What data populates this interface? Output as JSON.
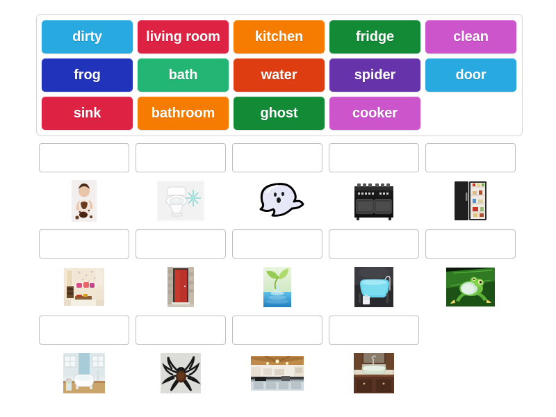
{
  "activity": {
    "type": "match-up",
    "tile_bank": {
      "rows": [
        [
          {
            "label": "dirty",
            "color": "#28a9e0"
          },
          {
            "label": "living room",
            "color": "#dd2244"
          },
          {
            "label": "kitchen",
            "color": "#f57c00"
          },
          {
            "label": "fridge",
            "color": "#128a36"
          },
          {
            "label": "clean",
            "color": "#cc55cc"
          }
        ],
        [
          {
            "label": "frog",
            "color": "#2233bb"
          },
          {
            "label": "bath",
            "color": "#22b573"
          },
          {
            "label": "water",
            "color": "#dd3d11"
          },
          {
            "label": "spider",
            "color": "#6633aa"
          },
          {
            "label": "door",
            "color": "#28a9e0"
          }
        ],
        [
          {
            "label": "sink",
            "color": "#dd2244"
          },
          {
            "label": "bathroom",
            "color": "#f57c00"
          },
          {
            "label": "ghost",
            "color": "#128a36"
          },
          {
            "label": "cooker",
            "color": "#cc55cc"
          }
        ]
      ]
    },
    "answer_rows": [
      [
        {
          "drop_value": "",
          "image": "dirty-child-photo"
        },
        {
          "drop_value": "",
          "image": "toilet-photo"
        },
        {
          "drop_value": "",
          "image": "ghost-clipart"
        },
        {
          "drop_value": "",
          "image": "cooker-range-photo"
        },
        {
          "drop_value": "",
          "image": "fridge-photo"
        }
      ],
      [
        {
          "drop_value": "",
          "image": "living-room-photo"
        },
        {
          "drop_value": "",
          "image": "red-door-photo"
        },
        {
          "drop_value": "",
          "image": "water-drop-photo"
        },
        {
          "drop_value": "",
          "image": "bathtub-photo"
        },
        {
          "drop_value": "",
          "image": "green-frog-photo"
        }
      ],
      [
        {
          "drop_value": "",
          "image": "clean-bathroom-photo"
        },
        {
          "drop_value": "",
          "image": "spider-photo"
        },
        {
          "drop_value": "",
          "image": "kitchen-photo"
        },
        {
          "drop_value": "",
          "image": "sink-photo"
        }
      ]
    ]
  }
}
